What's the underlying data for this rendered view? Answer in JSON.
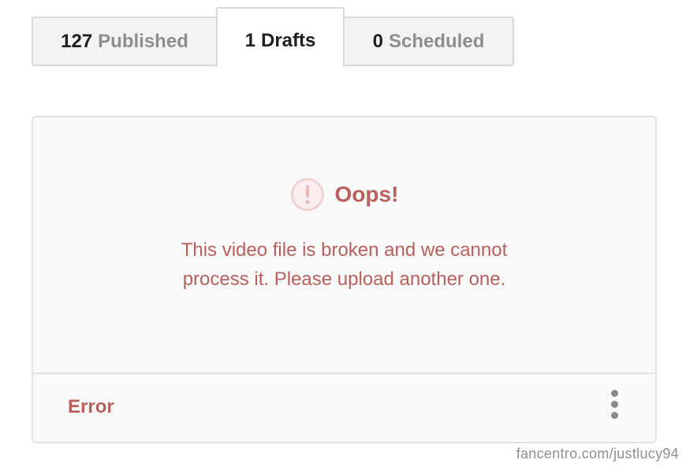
{
  "tabs": [
    {
      "count": "127",
      "label": "Published"
    },
    {
      "count": "1",
      "label": "Drafts"
    },
    {
      "count": "0",
      "label": "Scheduled"
    }
  ],
  "active_tab": "Drafts",
  "card": {
    "title": "Oops!",
    "message_line1": "This video file is broken and we cannot",
    "message_line2": "process it. Please upload another one.",
    "status": "Error",
    "icon": "warning-circle-icon",
    "more_icon": "more-vertical-icon"
  },
  "watermark": "fancentro.com/justlucy94",
  "colors": {
    "error": "#b9605c",
    "muted_label": "#8e8e8e",
    "border": "#e3e3e3"
  }
}
